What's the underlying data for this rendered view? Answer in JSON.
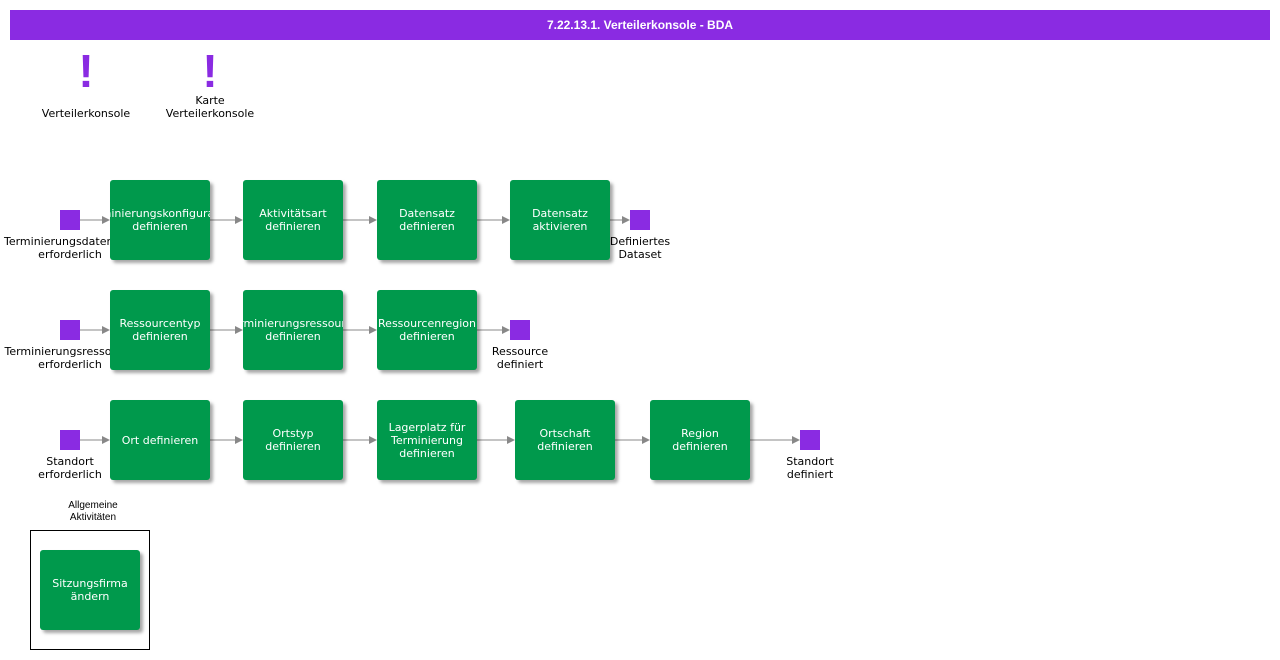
{
  "title": "7.22.13.1. Verteilerkonsole - BDA",
  "colors": {
    "accent": "#8a2be2",
    "task": "#00994c"
  },
  "annotations": [
    {
      "icon": "exclamation-icon",
      "label": "Verteilerkonsole"
    },
    {
      "icon": "exclamation-icon",
      "label": "Karte\nVerteilerkonsole"
    }
  ],
  "rows": [
    {
      "start": "Terminierungsdatensatz\nerforderlich",
      "tasks": [
        "Terminierungskonfiguration\ndefinieren",
        "Aktivitätsart\ndefinieren",
        "Datensatz\ndefinieren",
        "Datensatz\naktivieren"
      ],
      "end": "Definiertes\nDataset"
    },
    {
      "start": "Terminierungsressource\nerforderlich",
      "tasks": [
        "Ressourcentyp\ndefinieren",
        "Terminierungsressource\ndefinieren",
        "Ressourcenregion\ndefinieren"
      ],
      "end": "Ressource\ndefiniert"
    },
    {
      "start": "Standort\nerforderlich",
      "tasks": [
        "Ort definieren",
        "Ortstyp\ndefinieren",
        "Lagerplatz für\nTerminierung\ndefinieren",
        "Ortschaft\ndefinieren",
        "Region\ndefinieren"
      ],
      "end": "Standort\ndefiniert"
    }
  ],
  "general": {
    "label": "Allgemeine\nAktivitäten",
    "task": "Sitzungsfirma\nändern"
  }
}
